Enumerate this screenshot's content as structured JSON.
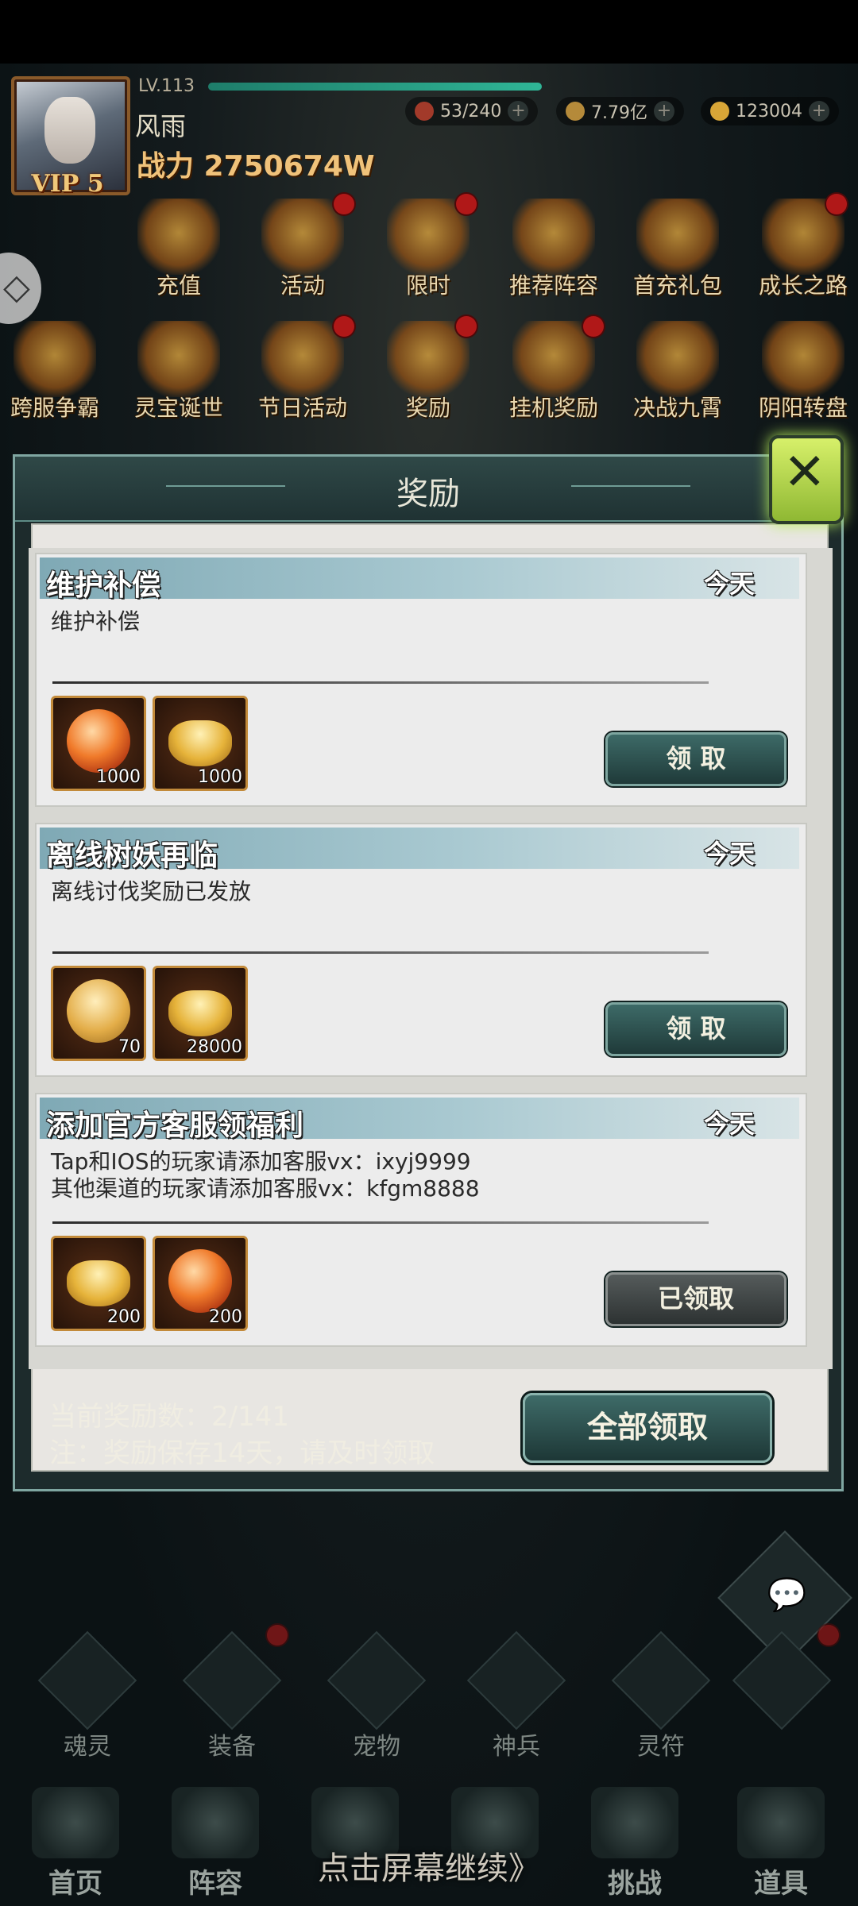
{
  "header": {
    "level": "LV.113",
    "vip": "VIP 5",
    "player_name": "风雨",
    "power": "战力 2750674W",
    "resources": [
      {
        "value": "53/240",
        "icon": "stamina-icon"
      },
      {
        "value": "7.79亿",
        "icon": "coin-icon"
      },
      {
        "value": "123004",
        "icon": "ingot-icon"
      }
    ]
  },
  "feature_icons": [
    {
      "label": "充值",
      "dot": false
    },
    {
      "label": "活动",
      "dot": true
    },
    {
      "label": "限时",
      "dot": true
    },
    {
      "label": "推荐阵容",
      "dot": false
    },
    {
      "label": "首充礼包",
      "dot": false
    },
    {
      "label": "成长之路",
      "dot": true
    },
    {
      "label": "跨服争霸",
      "dot": false
    },
    {
      "label": "灵宝诞世",
      "dot": false
    },
    {
      "label": "节日活动",
      "dot": true
    },
    {
      "label": "奖励",
      "dot": true
    },
    {
      "label": "挂机奖励",
      "dot": true
    },
    {
      "label": "决战九霄",
      "dot": false
    },
    {
      "label": "阴阳转盘",
      "dot": false
    }
  ],
  "dialog": {
    "title": "奖励",
    "cards": [
      {
        "title": "维护补偿",
        "date": "今天",
        "desc_lines": [
          "维护补偿",
          ""
        ],
        "items": [
          {
            "type": "orb",
            "qty": "1000"
          },
          {
            "type": "ingot",
            "qty": "1000"
          }
        ],
        "button": "领 取",
        "claimed": false
      },
      {
        "title": "离线树妖再临",
        "date": "今天",
        "desc_lines": [
          "离线讨伐奖励已发放",
          ""
        ],
        "items": [
          {
            "type": "gold",
            "qty": "70"
          },
          {
            "type": "ingot",
            "qty": "28000"
          }
        ],
        "button": "领 取",
        "claimed": false
      },
      {
        "title": "添加官方客服领福利",
        "date": "今天",
        "desc_lines": [
          "Tap和IOS的玩家请添加客服vx：ixyj9999",
          "其他渠道的玩家请添加客服vx：kfgm8888"
        ],
        "items": [
          {
            "type": "ingot",
            "qty": "200"
          },
          {
            "type": "orb",
            "qty": "200"
          }
        ],
        "button": "已领取",
        "claimed": true
      }
    ],
    "footer_count": "当前奖励数：2/141",
    "footer_note": "注：奖励保存14天，请及时领取",
    "claim_all": "全部领取"
  },
  "nav_secondary": [
    "魂灵",
    "装备",
    "宠物",
    "神兵",
    "灵符",
    "+"
  ],
  "nav_primary": [
    "首页",
    "阵容",
    "",
    "",
    "挑战",
    "道具"
  ],
  "tap_hint": "点击屏幕继续》"
}
